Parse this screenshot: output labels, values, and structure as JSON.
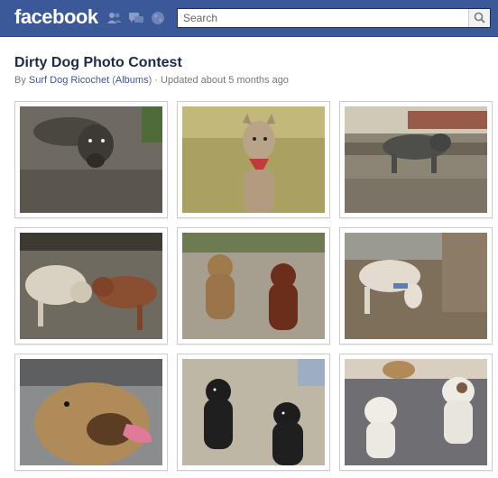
{
  "header": {
    "logo_text": "facebook",
    "icons": [
      "friend-requests-icon",
      "messages-icon",
      "notifications-globe-icon",
      "search-magnifier-icon"
    ],
    "search_placeholder": "Search",
    "brand_color": "#3b5998"
  },
  "album": {
    "title": "Dirty Dog Photo Contest",
    "by_prefix": "By ",
    "owner": "Surf Dog Ricochet",
    "open_paren": " (",
    "albums_link": "Albums",
    "close_paren": ")",
    "updated": " · Updated about 5 months ago"
  },
  "photos": [
    {
      "subject": "muddy dark dog lying in mud"
    },
    {
      "subject": "scruffy dog with red bandana in grass"
    },
    {
      "subject": "gray dog walking near muddy water"
    },
    {
      "subject": "two dogs playing in muddy field"
    },
    {
      "subject": "golden dog and brown dog sitting on sand"
    },
    {
      "subject": "white dog with blue harness sniffing ground"
    },
    {
      "subject": "close-up of dog with tongue out"
    },
    {
      "subject": "two black labs sitting on concrete"
    },
    {
      "subject": "two white puppies on floor"
    }
  ]
}
